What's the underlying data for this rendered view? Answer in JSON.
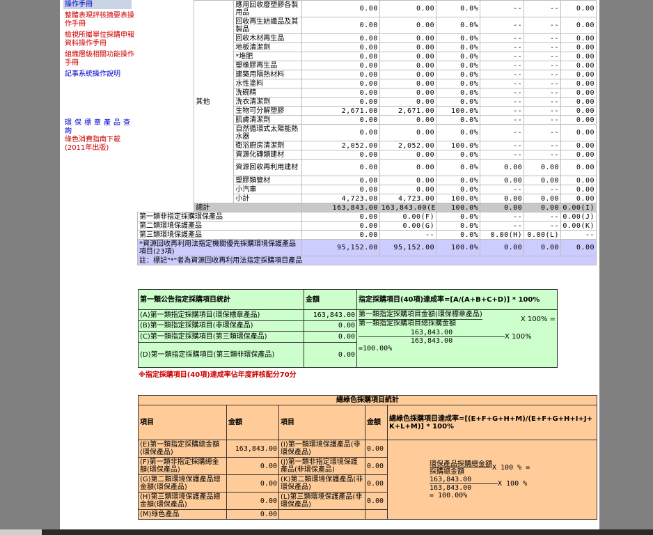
{
  "sidebar": {
    "items": [
      {
        "label": "操作手冊",
        "style": "first"
      },
      {
        "label": "整體表現評核摘要表操作手冊",
        "style": "red"
      },
      {
        "label": "檢視所屬單位採購申報資料操作手冊",
        "style": "red"
      },
      {
        "label": "組織層級相關功能操作手冊",
        "style": "red"
      },
      {
        "label": "記事系統操作說明",
        "style": "blue"
      }
    ],
    "query": "環保標章產品查詢",
    "guide": "綠色消費指南下載(2011年出版)"
  },
  "top_table": {
    "group_label": "其他",
    "rows": [
      {
        "name": "應用回收廢塑膠各製用品",
        "c1": "0.00",
        "c2": "0.00",
        "c3": "0.0%",
        "c4": "--",
        "c5": "--",
        "c6": "0.00"
      },
      {
        "name": "回收再生紡織品及其製品",
        "c1": "0.00",
        "c2": "0.00",
        "c3": "0.0%",
        "c4": "--",
        "c5": "--",
        "c6": "0.00"
      },
      {
        "name": "回收木材再生品",
        "c1": "0.00",
        "c2": "0.00",
        "c3": "0.0%",
        "c4": "--",
        "c5": "--",
        "c6": "0.00"
      },
      {
        "name": "地板清潔劑",
        "c1": "0.00",
        "c2": "0.00",
        "c3": "0.0%",
        "c4": "--",
        "c5": "--",
        "c6": "0.00"
      },
      {
        "name": "*堆肥",
        "c1": "0.00",
        "c2": "0.00",
        "c3": "0.0%",
        "c4": "--",
        "c5": "--",
        "c6": "0.00"
      },
      {
        "name": "塑橡膠再生品",
        "c1": "0.00",
        "c2": "0.00",
        "c3": "0.0%",
        "c4": "--",
        "c5": "--",
        "c6": "0.00"
      },
      {
        "name": "建築用隔熱材料",
        "c1": "0.00",
        "c2": "0.00",
        "c3": "0.0%",
        "c4": "--",
        "c5": "--",
        "c6": "0.00"
      },
      {
        "name": "水性塗料",
        "c1": "0.00",
        "c2": "0.00",
        "c3": "0.0%",
        "c4": "--",
        "c5": "--",
        "c6": "0.00"
      },
      {
        "name": "洗碗精",
        "c1": "0.00",
        "c2": "0.00",
        "c3": "0.0%",
        "c4": "--",
        "c5": "--",
        "c6": "0.00"
      },
      {
        "name": "洗衣清潔劑",
        "c1": "0.00",
        "c2": "0.00",
        "c3": "0.0%",
        "c4": "--",
        "c5": "--",
        "c6": "0.00"
      },
      {
        "name": "生物可分解塑膠",
        "c1": "2,671.00",
        "c2": "2,671.00",
        "c3": "100.0%",
        "c4": "--",
        "c5": "--",
        "c6": "0.00"
      },
      {
        "name": "肌膚清潔劑",
        "c1": "0.00",
        "c2": "0.00",
        "c3": "0.0%",
        "c4": "--",
        "c5": "--",
        "c6": "0.00"
      },
      {
        "name": "自然循環式太陽能熱水器",
        "c1": "0.00",
        "c2": "0.00",
        "c3": "0.0%",
        "c4": "--",
        "c5": "--",
        "c6": "0.00"
      },
      {
        "name": "衛浴廚房清潔劑",
        "c1": "2,052.00",
        "c2": "2,052.00",
        "c3": "100.0%",
        "c4": "--",
        "c5": "--",
        "c6": "0.00"
      },
      {
        "name": "資源化磚類建材",
        "c1": "0.00",
        "c2": "0.00",
        "c3": "0.0%",
        "c4": "--",
        "c5": "--",
        "c6": "0.00"
      },
      {
        "name": "資源回收再利用建材",
        "c1": "0.00",
        "c2": "0.00",
        "c3": "0.0%",
        "c4": "0.00",
        "c5": "0.00",
        "c6": "0.00"
      },
      {
        "name": "塑膠類管材",
        "c1": "0.00",
        "c2": "0.00",
        "c3": "0.0%",
        "c4": "0.00",
        "c5": "0.00",
        "c6": "0.00"
      },
      {
        "name": "小汽車",
        "c1": "0.00",
        "c2": "0.00",
        "c3": "0.0%",
        "c4": "--",
        "c5": "--",
        "c6": "0.00"
      },
      {
        "name": "小計",
        "c1": "4,723.00",
        "c2": "4,723.00",
        "c3": "100.0%",
        "c4": "0.00",
        "c5": "0.00",
        "c6": "0.00"
      }
    ],
    "total": {
      "name": "總計",
      "c1": "163,843.00",
      "c2": "163,843.00(E)",
      "c3": "100.0%",
      "c4": "0.00",
      "c5": "0.00",
      "c6": "0.00(I)"
    },
    "cat_rows": [
      {
        "name": "第一類非指定採購環保產品",
        "c1": "0.00",
        "c2": "0.00(F)",
        "c3": "0.0%",
        "c4": "--",
        "c5": "--",
        "c6": "0.00(J)"
      },
      {
        "name": "第二類環境保護產品",
        "c1": "0.00",
        "c2": "0.00(G)",
        "c3": "0.0%",
        "c4": "--",
        "c5": "--",
        "c6": "0.00(K)"
      },
      {
        "name": "第三類環境保護產品",
        "c1": "0.00",
        "c2": "--",
        "c3": "0.0%",
        "c4": "0.00(H)",
        "c5": "0.00(L)",
        "c6": "--"
      }
    ],
    "priority": {
      "name": "*資源回收再利用法指定機關優先採購環境保護產品項目(23項)",
      "c1": "95,152.00",
      "c2": "95,152.00",
      "c3": "100.0%",
      "c4": "0.00",
      "c5": "0.00",
      "c6": "0.00"
    },
    "note": "註：標記\"*\"者為資源回收再利用法指定採購項目產品"
  },
  "green_table": {
    "title": "第一類公告指定採購項目統計",
    "amount_header": "金額",
    "rate_header": "指定採購項目(40項)達成率=[A/(A+B+C+D)] * 100%",
    "rows": [
      {
        "label": "(A)第一類指定採購項目(環保標章產品)",
        "value": "163,843.00"
      },
      {
        "label": "(B)第一類指定採購項目(非環保產品)",
        "value": "0.00"
      },
      {
        "label": "(C)第一類指定採購項目(第三類環保產品)",
        "value": "0.00"
      },
      {
        "label": "(D)第一類指定採購項目(第三類非環保產品)",
        "value": "0.00"
      }
    ],
    "formula": {
      "numerator_label": "第一類指定採購項目金額(環保標章產品)",
      "denominator_label": "第一類指定採購項目總採購金額",
      "times1": "X 100% =",
      "num_val": "163,843.00",
      "den_val": "163,843.00",
      "times2": "X 100%",
      "result": "=100.00%"
    }
  },
  "warning": "※指定採購項目(40項)達成率佔年度評核配分70分",
  "orange_table": {
    "title": "總綠色採購項目統計",
    "h_item": "項目",
    "h_amount": "金額",
    "h_item2": "項目",
    "h_amount2": "金額",
    "rate_header": "總綠色採購項目達成率=[(E+F+G+H+M)/(E+F+G+H+I+J+K+L+M)] * 100%",
    "rows": [
      {
        "l": "(E)第一類指定採購總金額(環保產品)",
        "lv": "163,843.00",
        "r": "(I)第一類環境保護產品(非環保產品)",
        "rv": "0.00"
      },
      {
        "l": "(F)第一類非指定採購總金額(環保產品)",
        "lv": "0.00",
        "r": "(J)第一類非指定環境保護產品(非環保產品)",
        "rv": "0.00"
      },
      {
        "l": "(G)第二類環境保護產品總金額(環保產品)",
        "lv": "0.00",
        "r": "(K)第二類環境保護產品(非環保產品)",
        "rv": "0.00"
      },
      {
        "l": "(H)第三類環境保護產品總金額(環保產品)",
        "lv": "0.00",
        "r": "(L)第三類環境保護產品(非環保產品)",
        "rv": "0.00"
      },
      {
        "l": "(M)綠色產品",
        "lv": "0.00",
        "r": "",
        "rv": ""
      }
    ],
    "formula": {
      "numerator_label": "環保產品採購總金額",
      "denominator_label": "採購總金額",
      "times1": "X 100 % =",
      "num_val": "163,843.00",
      "den_val": "163,843.00",
      "times2": "X 100 %",
      "result": "= 100.00%"
    }
  }
}
